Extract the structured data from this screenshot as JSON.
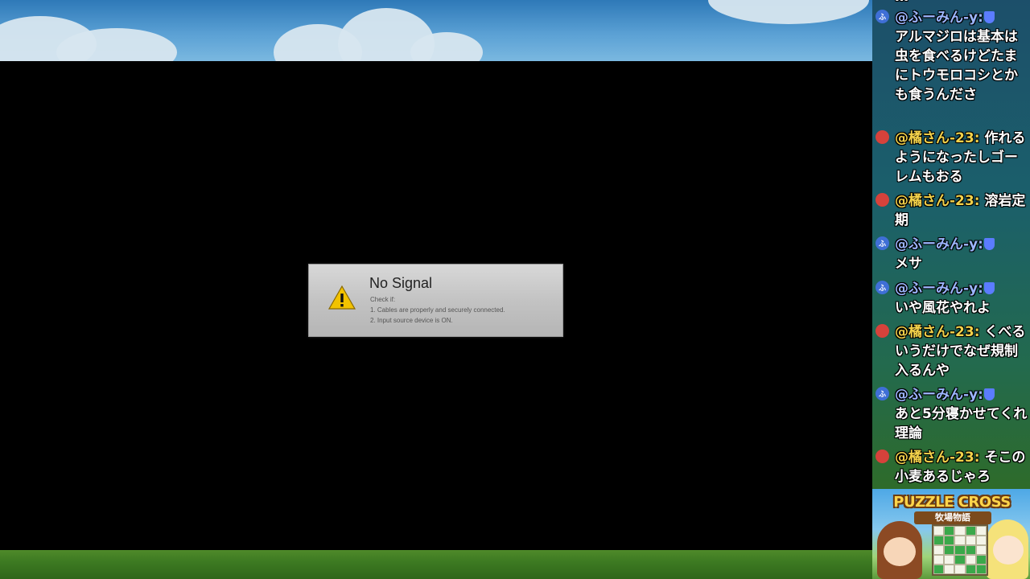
{
  "dialog": {
    "title": "No Signal",
    "check_label": "Check if:",
    "lines": [
      "1. Cables are properly and securely connected.",
      "2. Input source device is ON."
    ],
    "icon": "warning-icon"
  },
  "chat": {
    "messages": [
      {
        "avatar": "ふ",
        "avatar_color": "#3f6fd6",
        "author": "@ふーみん-y:",
        "moderator": true,
        "text": "アルマジロは基本は虫を食べるけどたまにトウモロコシとかも食うんださ"
      },
      {
        "avatar": "",
        "avatar_color": "#d6423b",
        "author": "@橘さん-23:",
        "moderator": false,
        "text": "作れるようになったしゴーレムもおる"
      },
      {
        "avatar": "",
        "avatar_color": "#d6423b",
        "author": "@橘さん-23:",
        "moderator": false,
        "text": "溶岩定期"
      },
      {
        "avatar": "ふ",
        "avatar_color": "#3f6fd6",
        "author": "@ふーみん-y:",
        "moderator": true,
        "text": "メサ"
      },
      {
        "avatar": "ふ",
        "avatar_color": "#3f6fd6",
        "author": "@ふーみん-y:",
        "moderator": true,
        "text": "いや風花やれよ"
      },
      {
        "avatar": "",
        "avatar_color": "#d6423b",
        "author": "@橘さん-23:",
        "moderator": false,
        "text": "くべるいうだけでなぜ規制入るんや"
      },
      {
        "avatar": "ふ",
        "avatar_color": "#3f6fd6",
        "author": "@ふーみん-y:",
        "moderator": true,
        "text": "あと5分寝かせてくれ理論"
      },
      {
        "avatar": "",
        "avatar_color": "#d6423b",
        "author": "@橘さん-23:",
        "moderator": false,
        "text": "そこの小麦あるじゃろ"
      }
    ]
  },
  "thumbnail": {
    "logo": "PUZZLE CROSS",
    "subtitle": "牧場物語"
  },
  "colors": {
    "author_name": "#f2d14a",
    "moderator_shield": "#5b7cff",
    "chat_text": "#ffffff"
  }
}
